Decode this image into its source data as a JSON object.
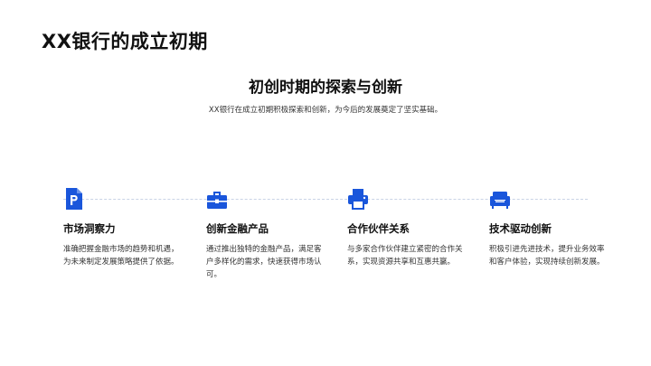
{
  "slide": {
    "title": "XX银行的成立初期"
  },
  "hero": {
    "title": "初创时期的探索与创新",
    "subtitle": "XX银行在成立初期积极探索和创新，为今后的发展奠定了坚实基础。"
  },
  "theme": {
    "accent": "#1a56db",
    "line": "#c9d3e6"
  },
  "steps": [
    {
      "icon": "document-p-icon",
      "title": "市场洞察力",
      "desc": "准确把握金融市场的趋势和机遇，为未来制定发展策略提供了依据。"
    },
    {
      "icon": "briefcase-icon",
      "title": "创新金融产品",
      "desc": "通过推出独特的金融产品，满足客户多样化的需求，快速获得市场认可。"
    },
    {
      "icon": "printer-icon",
      "title": "合作伙伴关系",
      "desc": "与多家合作伙伴建立紧密的合作关系，实现资源共享和互惠共赢。"
    },
    {
      "icon": "sofa-icon",
      "title": "技术驱动创新",
      "desc": "积极引进先进技术，提升业务效率和客户体验，实现持续创新发展。"
    }
  ]
}
